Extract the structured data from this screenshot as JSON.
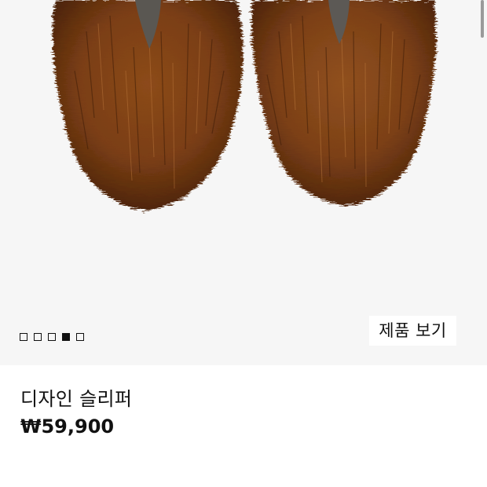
{
  "product": {
    "name": "디자인 슬리퍼",
    "price": "₩59,900"
  },
  "gallery": {
    "image_count": 5,
    "active_index": 3,
    "view_button_label": "제품 보기"
  },
  "colors": {
    "fur": "#7a3e14",
    "image_background": "#f6f6f6",
    "active_dot": "#111111"
  }
}
